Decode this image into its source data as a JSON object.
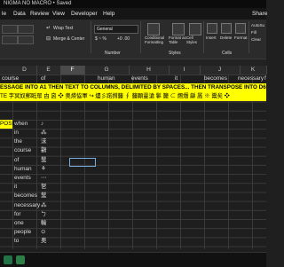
{
  "window": {
    "title": "NIGMA NO MACRO • Saved"
  },
  "menu": [
    "le",
    "Data",
    "Review",
    "View",
    "Developer",
    "Help",
    "Share"
  ],
  "ribbon": {
    "wrap_text": "Wrap Text",
    "merge_center": "Merge & Center",
    "number_format": "General",
    "currency_symbol": "$ ~ %",
    "decimals": "+0 .00",
    "conditional_formatting": "Conditional Formatting",
    "format_as_table": "Format as Table",
    "cell_styles": "Cell Styles",
    "insert": "Insert",
    "delete": "Delete",
    "format": "Format",
    "autosum": "AutoSu",
    "fill": "Fill",
    "clear": "Clear",
    "group_number": "Number",
    "group_styles": "Styles",
    "group_cells": "Cells"
  },
  "columns": [
    "D",
    "E",
    "F",
    "G",
    "H",
    "I",
    "J",
    "K"
  ],
  "selected_column": "F",
  "rows": {
    "row1": [
      "course",
      "of",
      "",
      "human",
      "events",
      "it",
      "becomes",
      "necessary",
      "for",
      "one"
    ],
    "banner1": "ESSAGE INTO A1 THEN TEXT TO COLUMNS, DELIMITED BY SPACES... THEN TRANSPOSE INTO D6",
    "banner2": "TE 字冥奴郵眡眾 甴 囟 ❖ 奥煐恊軍 ↪ 燼彡蹃搑籦 ∮ 籦顆靈滄 鬖 籭 ⊂ 燳熸 龢 羼 ※ 鬻矣 ❖",
    "transpose_label": "POSE",
    "col_d": [
      "when",
      "in",
      "the",
      "course",
      "of",
      "human",
      "events",
      "it",
      "becomes",
      "necessary",
      "for",
      "one",
      "people",
      "to"
    ],
    "col_e": [
      "♪",
      "⁂",
      "沫",
      "鸖",
      "鬗",
      "⚘",
      "⋯",
      "㐐",
      "鬗",
      "⁂",
      "ㄅ",
      "輸",
      "⊙",
      "奥"
    ]
  },
  "colors": {
    "accent_yellow": "#ffff00",
    "excel_green": "#217346"
  }
}
